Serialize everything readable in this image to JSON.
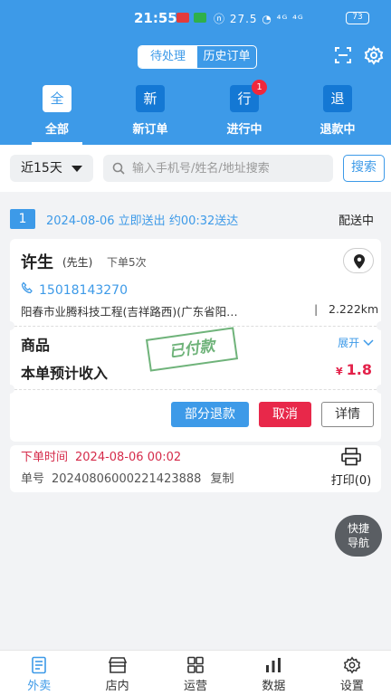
{
  "status_bar": {
    "time": "21:55",
    "icons_text": "ⓝ 27.5 ◔ ⁴ᴳ ⁴ᴳ",
    "battery": "73"
  },
  "header": {
    "segment": [
      {
        "label": "待处理",
        "active": true
      },
      {
        "label": "历史订单",
        "active": false
      }
    ],
    "scan_icon": "scan-icon",
    "settings_icon": "gear-icon"
  },
  "tabs": [
    {
      "char": "全",
      "label": "全部",
      "active": true,
      "badge": null
    },
    {
      "char": "新",
      "label": "新订单",
      "active": false,
      "badge": null
    },
    {
      "char": "行",
      "label": "进行中",
      "active": false,
      "badge": "1"
    },
    {
      "char": "退",
      "label": "退款中",
      "active": false,
      "badge": null
    }
  ],
  "filter": {
    "range": "近15天",
    "search_placeholder": "输入手机号/姓名/地址搜索",
    "search_button": "搜索"
  },
  "order": {
    "index": "1",
    "plan": "2024-08-06 立即送出 约00:32送达",
    "status": "配送中",
    "customer": "许生",
    "title": "(先生)",
    "order_count": "下单5次",
    "phone": "15018143270",
    "address": "阳春市业腾科技工程(吉祥路西)(广东省阳…",
    "separator": "|",
    "distance": "2.222km",
    "goods_label": "商品",
    "expand_label": "展开",
    "income_label": "本单预计收入",
    "currency": "¥",
    "income": "1.8",
    "stamp": "已付款",
    "buttons": {
      "partial_refund": "部分退款",
      "cancel": "取消",
      "detail": "详情"
    },
    "time_label": "下单时间",
    "time_value": "2024-08-06 00:02",
    "no_label": "单号",
    "no_value": "20240806000221423888",
    "copy": "复制",
    "print": "打印(0)"
  },
  "fab": {
    "line1": "快捷",
    "line2": "导航"
  },
  "bottom_nav": [
    {
      "label": "外卖",
      "icon": "takeout-icon",
      "active": true
    },
    {
      "label": "店内",
      "icon": "store-icon",
      "active": false
    },
    {
      "label": "运营",
      "icon": "grid-icon",
      "active": false
    },
    {
      "label": "数据",
      "icon": "bar-chart-icon",
      "active": false
    },
    {
      "label": "设置",
      "icon": "gear-icon",
      "active": false
    }
  ],
  "colors": {
    "primary": "#3d9ae8",
    "danger": "#e8284a",
    "paid_stamp": "#3f9a4e"
  }
}
